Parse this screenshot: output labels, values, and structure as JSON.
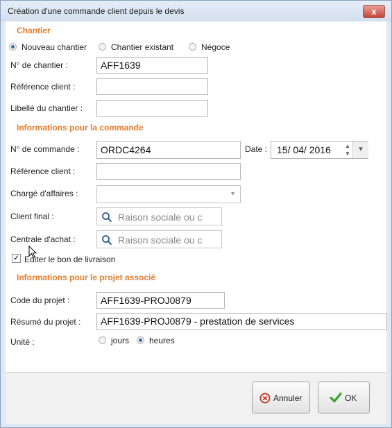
{
  "window": {
    "title": "Création d'une commande client depuis le devis",
    "close_label": "x"
  },
  "chantier": {
    "section_title": "Chantier",
    "radios": [
      {
        "label": "Nouveau chantier",
        "checked": true
      },
      {
        "label": "Chantier existant",
        "checked": false
      },
      {
        "label": "Négoce",
        "checked": false
      }
    ],
    "numero_label": "N° de chantier :",
    "numero_value": "AFF1639",
    "reference_label": "Référence client :",
    "reference_value": "",
    "libelle_label": "Libellé du chantier :",
    "libelle_value": ""
  },
  "commande": {
    "section_title": "Informations pour la commande",
    "numero_label": "N° de commande :",
    "numero_value": "ORDC4264",
    "date_label": "Date :",
    "date_value": "15/ 04/  2016",
    "reference_label": "Référence client :",
    "reference_value": "",
    "charge_label": "Chargé d'affaires :",
    "charge_value": "",
    "client_final_label": "Client final :",
    "client_final_placeholder": "Raison sociale ou c",
    "centrale_label": "Centrale d'achat :",
    "centrale_placeholder": "Raison sociale ou c",
    "editer_label": "Editer le bon de livraison",
    "editer_checked": true
  },
  "projet": {
    "section_title": "Informations pour le projet associé",
    "code_label": "Code du projet :",
    "code_value": "AFF1639-PROJ0879",
    "resume_label": "Résumé du projet :",
    "resume_value": "AFF1639-PROJ0879 - prestation de services",
    "unite_label": "Unité :",
    "unite_options": [
      {
        "label": "jours",
        "checked": false
      },
      {
        "label": "heures",
        "checked": true
      }
    ]
  },
  "footer": {
    "cancel_label": "Annuler",
    "ok_label": "OK"
  }
}
